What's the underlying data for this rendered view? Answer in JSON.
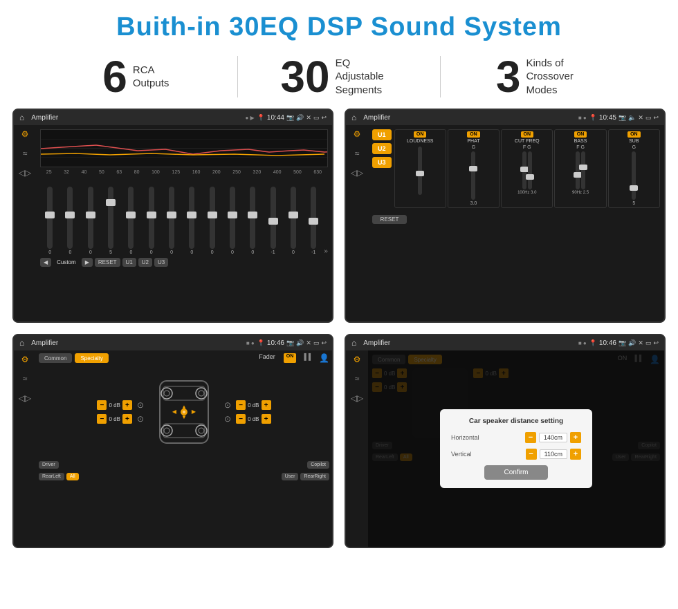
{
  "header": {
    "title": "Buith-in 30EQ DSP Sound System"
  },
  "stats": [
    {
      "number": "6",
      "desc_line1": "RCA",
      "desc_line2": "Outputs"
    },
    {
      "number": "30",
      "desc_line1": "EQ Adjustable",
      "desc_line2": "Segments"
    },
    {
      "number": "3",
      "desc_line1": "Kinds of",
      "desc_line2": "Crossover Modes"
    }
  ],
  "screens": [
    {
      "id": "eq-screen",
      "status_bar": {
        "title": "Amplifier",
        "time": "10:44"
      },
      "eq_freq_labels": [
        "25",
        "32",
        "40",
        "50",
        "63",
        "80",
        "100",
        "125",
        "160",
        "200",
        "250",
        "320",
        "400",
        "500",
        "630"
      ],
      "eq_values": [
        "0",
        "0",
        "0",
        "5",
        "0",
        "0",
        "0",
        "0",
        "0",
        "0",
        "0",
        "-1",
        "0",
        "-1"
      ],
      "eq_preset": "Custom",
      "eq_buttons": [
        "RESET",
        "U1",
        "U2",
        "U3"
      ]
    },
    {
      "id": "crossover-screen",
      "status_bar": {
        "title": "Amplifier",
        "time": "10:45"
      },
      "channels": [
        {
          "name": "LOUDNESS",
          "on": true
        },
        {
          "name": "PHAT",
          "on": true
        },
        {
          "name": "CUT FREQ",
          "on": true
        },
        {
          "name": "BASS",
          "on": true
        },
        {
          "name": "SUB",
          "on": true
        }
      ],
      "u_buttons": [
        "U1",
        "U2",
        "U3"
      ],
      "reset_btn": "RESET"
    },
    {
      "id": "fader-screen",
      "status_bar": {
        "title": "Amplifier",
        "time": "10:46"
      },
      "tabs": [
        "Common",
        "Specialty"
      ],
      "active_tab": "Specialty",
      "fader_label": "Fader",
      "fader_on": "ON",
      "db_values": [
        "0 dB",
        "0 dB",
        "0 dB",
        "0 dB"
      ],
      "bottom_buttons": [
        "Driver",
        "RearLeft",
        "All",
        "User",
        "Copilot",
        "RearRight"
      ]
    },
    {
      "id": "dialog-screen",
      "status_bar": {
        "title": "Amplifier",
        "time": "10:46"
      },
      "tabs": [
        "Common",
        "Specialty"
      ],
      "dialog": {
        "title": "Car speaker distance setting",
        "horizontal_label": "Horizontal",
        "horizontal_value": "140cm",
        "vertical_label": "Vertical",
        "vertical_value": "110cm",
        "confirm_btn": "Confirm"
      },
      "db_values": [
        "0 dB",
        "0 dB"
      ],
      "bottom_buttons": [
        "Driver",
        "RearLeft",
        "All",
        "User",
        "Copilot",
        "RearRight"
      ]
    }
  ]
}
